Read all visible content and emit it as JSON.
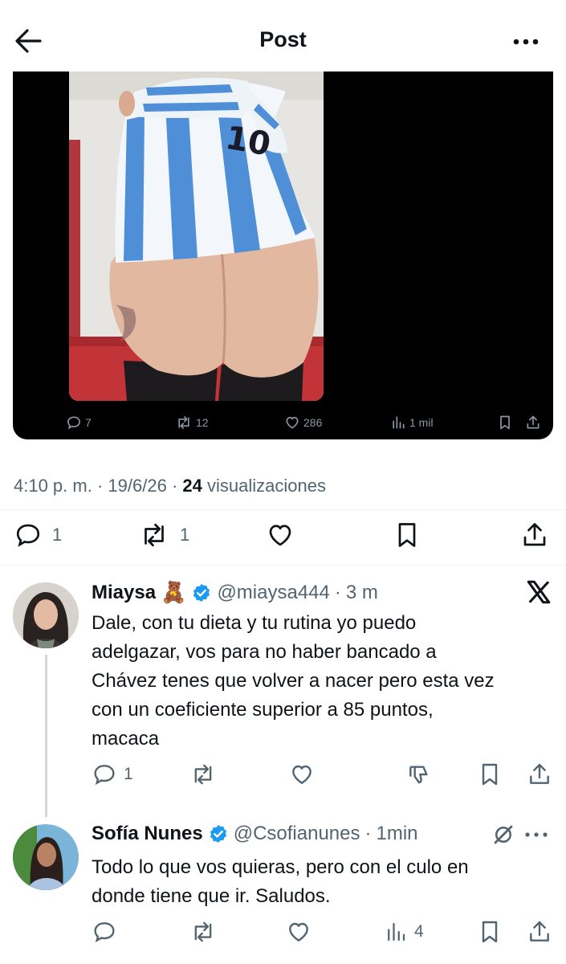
{
  "header": {
    "title": "Post"
  },
  "media": {
    "jersey_number": "10",
    "actions": {
      "replies": "7",
      "reposts": "12",
      "likes": "286",
      "views": "1 mil"
    }
  },
  "post": {
    "time": "4:10 p. m.",
    "date": "19/6/26",
    "views_count": "24",
    "views_label": "visualizaciones",
    "reply_count": "1",
    "repost_count": "1"
  },
  "replies": [
    {
      "name": "Miaysa",
      "emoji": "🧸",
      "handle": "@miaysa444",
      "time": "3 m",
      "text": "Dale, con tu dieta y tu rutina yo puedo\nadelgazar, vos para no haber bancado a\nChávez tenes que volver a nacer pero esta vez\ncon un coeficiente superior a 85 puntos,\nmacaca",
      "reply_count": "1"
    },
    {
      "name": "Sofía Nunes",
      "handle": "@Csofianunes",
      "time": "1min",
      "text": "Todo lo que vos quieras, pero con el culo en\ndonde tiene que ir. Saludos.",
      "views": "4"
    }
  ],
  "colors": {
    "verified": "#1d9bf0",
    "muted": "#536471",
    "text": "#0f1419"
  }
}
